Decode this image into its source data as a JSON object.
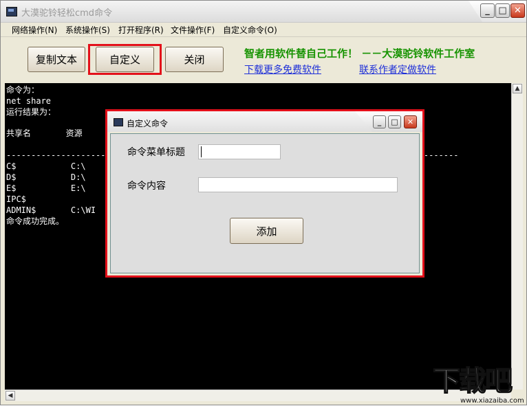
{
  "window": {
    "title": "大漠驼铃轻松cmd命令",
    "minimize_glyph": "_",
    "maximize_glyph": "□",
    "close_glyph": "✕"
  },
  "menu": [
    {
      "label": "网络操作(N)"
    },
    {
      "label": "系统操作(S)"
    },
    {
      "label": "打开程序(R)"
    },
    {
      "label": "文件操作(F)"
    },
    {
      "label": "自定义命令(O)"
    }
  ],
  "toolbar": {
    "copy_label": "复制文本",
    "custom_label": "自定义",
    "close_label": "关闭",
    "slogan": "智者用软件替自己工作！ －－大漠驼铃软件工作室",
    "link_download": "下载更多免费软件",
    "link_contact": "联系作者定做软件"
  },
  "console": {
    "lines": [
      "命令为：",
      "net share",
      "运行结果为：",
      "",
      "共享名       资源",
      "",
      "-------------------------------------------------------------------------------------------",
      "C$           C:\\",
      "D$           D:\\",
      "E$           E:\\",
      "IPC$",
      "ADMIN$       C:\\WI",
      "命令成功完成。"
    ]
  },
  "dialog": {
    "title": "自定义命令",
    "menu_title_label": "命令菜单标题",
    "menu_title_value": "",
    "content_label": "命令内容",
    "content_value": "",
    "add_label": "添加",
    "minimize_glyph": "_",
    "maximize_glyph": "□",
    "close_glyph": "✕"
  },
  "scroll": {
    "up_glyph": "▲",
    "left_glyph": "◀"
  },
  "watermark": {
    "big": "下载吧",
    "small": "www.xiazaiba.com"
  }
}
